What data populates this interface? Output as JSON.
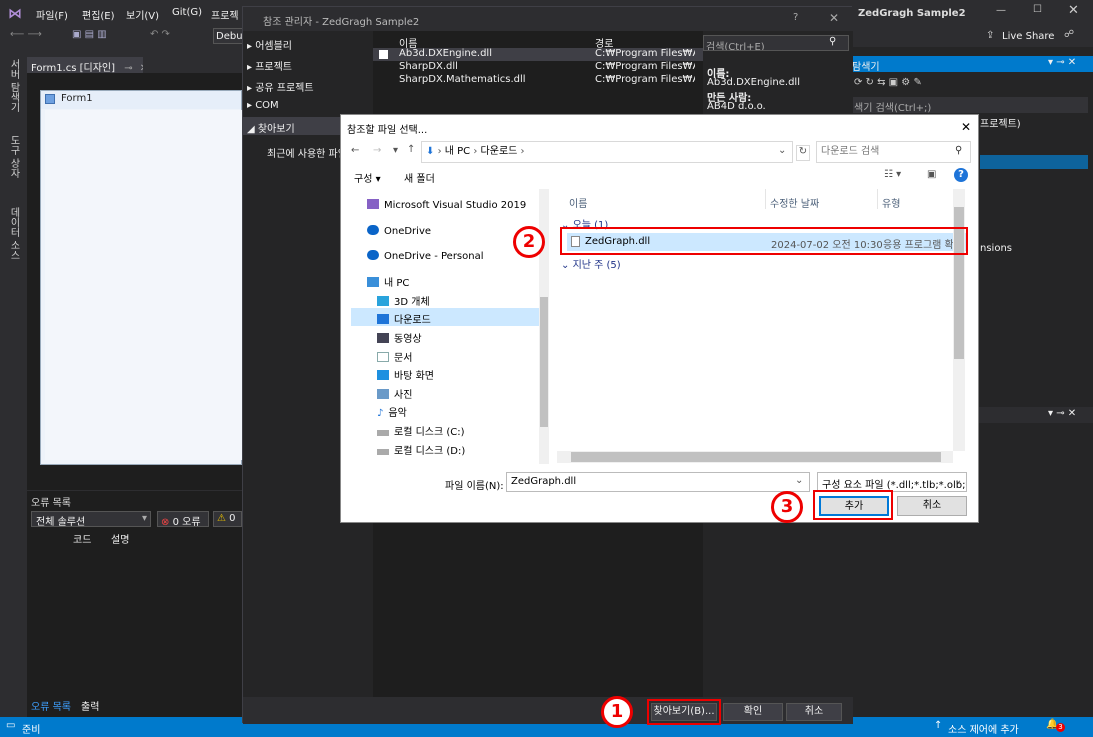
{
  "vs": {
    "menu": [
      "파일(F)",
      "편집(E)",
      "보기(V)",
      "Git(G)",
      "프로젝"
    ],
    "toolbar_debug": "Debu",
    "window_title": "ZedGragh Sample2",
    "live_share": "Live Share",
    "left_tabs": [
      "서버 탐색기",
      "도구 상자",
      "데이터 소스"
    ],
    "doc_tab": "Form1.cs [디자인]",
    "form_title": "Form1",
    "error_panel": {
      "title": "오류 목록",
      "scope": "전체 솔루션",
      "errors": "0 오류",
      "warnings": "0",
      "col_code": "코드",
      "col_desc": "설명",
      "tab_errors": "오류 목록",
      "tab_output": "출력"
    },
    "right_panel": {
      "title_fragment": "탐색기",
      "search": "색기 검색(Ctrl+;)",
      "project": "프로젝트)",
      "extensions": "nsions"
    },
    "status": {
      "ready": "준비",
      "source_control": "소스 제어에 추가",
      "badge": "3"
    }
  },
  "refmgr": {
    "title": "참조 관리자 - ZedGragh Sample2",
    "nav": [
      "어셈블리",
      "프로젝트",
      "공유 프로젝트",
      "COM",
      "찾아보기"
    ],
    "recent": "최근에 사용한 파일",
    "search_placeholder": "검색(Ctrl+E)",
    "columns": {
      "name": "이름",
      "path": "경로"
    },
    "rows": [
      {
        "name": "Ab3d.DXEngine.dll",
        "path": "C:₩Program Files₩Ab..."
      },
      {
        "name": "SharpDX.dll",
        "path": "C:₩Program Files₩Ab..."
      },
      {
        "name": "SharpDX.Mathematics.dll",
        "path": "C:₩Program Files₩Ab..."
      }
    ],
    "detail": {
      "name_label": "이름:",
      "name_value": "Ab3d.DXEngine.dll",
      "creator_label": "만든 사람:",
      "creator_value": "AB4D d.o.o."
    },
    "buttons": {
      "browse": "찾아보기(B)...",
      "ok": "확인",
      "cancel": "취소"
    }
  },
  "filedlg": {
    "title": "참조할 파일 선택...",
    "path": [
      "내 PC",
      "다운로드"
    ],
    "search_placeholder": "다운로드 검색",
    "toolbar": {
      "organize": "구성",
      "new_folder": "새 폴더"
    },
    "nav": [
      {
        "label": "Microsoft Visual Studio 2019",
        "icon": "vs-icon",
        "color": "#8661c5"
      },
      {
        "label": "OneDrive",
        "icon": "cloud-icon",
        "color": "#0a64c8"
      },
      {
        "label": "OneDrive - Personal",
        "icon": "cloud-icon",
        "color": "#0a64c8"
      },
      {
        "label": "내 PC",
        "icon": "pc-icon",
        "color": "#3a8fd9"
      },
      {
        "label": "3D 개체",
        "icon": "cube-icon",
        "color": "#29a3dc"
      },
      {
        "label": "다운로드",
        "icon": "download-icon",
        "color": "#1e74d8"
      },
      {
        "label": "동영상",
        "icon": "video-icon",
        "color": "#445"
      },
      {
        "label": "문서",
        "icon": "document-icon",
        "color": "#8aa"
      },
      {
        "label": "바탕 화면",
        "icon": "desktop-icon",
        "color": "#1e90e0"
      },
      {
        "label": "사진",
        "icon": "photo-icon",
        "color": "#6a9ac8"
      },
      {
        "label": "음악",
        "icon": "music-icon",
        "color": "#1e74d8"
      },
      {
        "label": "로컬 디스크 (C:)",
        "icon": "disk-icon",
        "color": "#888"
      },
      {
        "label": "로컬 디스크 (D:)",
        "icon": "disk-icon",
        "color": "#888"
      }
    ],
    "columns": {
      "name": "이름",
      "date": "수정한 날짜",
      "type": "유형"
    },
    "groups": [
      {
        "label": "오늘 (1)"
      },
      {
        "label": "지난 주 (5)"
      }
    ],
    "file": {
      "name": "ZedGraph.dll",
      "date": "2024-07-02 오전 10:30",
      "type": "응용 프로그램 확장"
    },
    "filename_label": "파일 이름(N):",
    "filename_value": "ZedGraph.dll",
    "filter": "구성 요소 파일 (*.dll;*.tlb;*.olb;*",
    "buttons": {
      "add": "추가",
      "cancel": "취소"
    }
  },
  "callouts": [
    "1",
    "2",
    "3"
  ],
  "colors": {
    "vs_dark": "#2d2d30",
    "vs_blue": "#007acc",
    "callout": "#e00000",
    "selection": "#cce8ff"
  }
}
